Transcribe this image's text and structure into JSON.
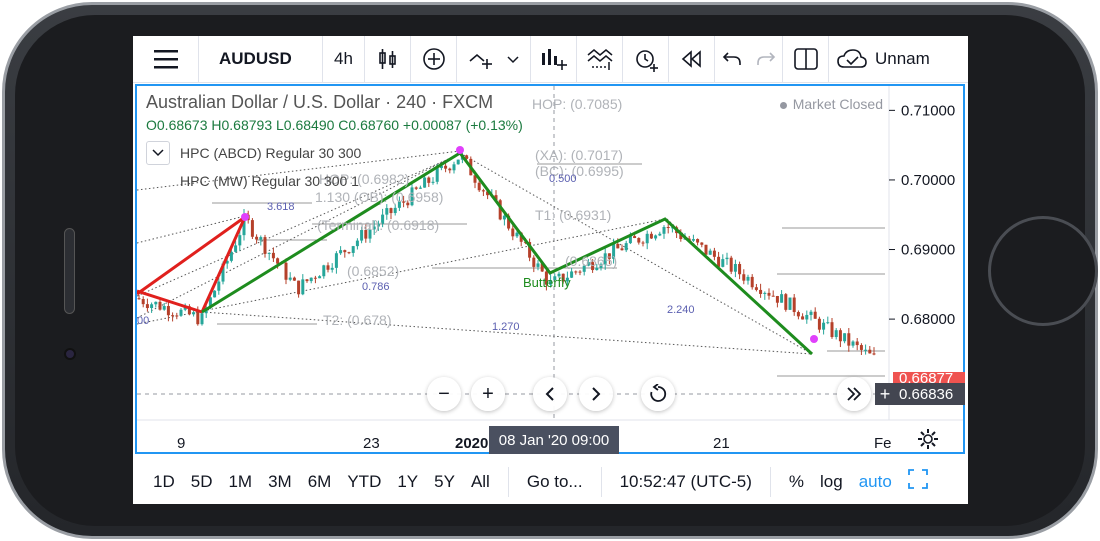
{
  "toolbar": {
    "symbol": "AUDUSD",
    "interval": "4h",
    "save_label": "Unnam",
    "icons": [
      "menu-icon",
      "candles-icon",
      "add-symbol-icon",
      "indicators-icon",
      "chevron-down-icon",
      "chart-type-icon",
      "templates-icon",
      "alert-icon",
      "replay-icon",
      "undo-icon",
      "redo-icon",
      "layout-icon",
      "cloud-icon"
    ]
  },
  "legend": {
    "title": "Australian Dollar / U.S. Dollar · 240 · FXCM",
    "open": "O0.68673",
    "high": "H0.68793",
    "low": "L0.68490",
    "close": "C0.68760",
    "change": "+0.00087 (+0.13%)",
    "study1": "HPC (ABCD) Regular 30 300",
    "study2": "HPC (MW) Regular 30 300 1",
    "market_status": "Market Closed"
  },
  "price_axis": {
    "ticks": [
      "0.71000",
      "0.70000",
      "0.69000",
      "0.68000"
    ],
    "partial_tag": "0.66877",
    "current_price": "0.66836",
    "partial_tag_color": "#ef5350",
    "current_tag_color": "#434651"
  },
  "time_axis": {
    "labels": [
      "9",
      "23",
      "2020",
      "21",
      "Fe"
    ],
    "crosshair_label": "08 Jan '20   09:00"
  },
  "annotations": {
    "hop_top": "HOP: (0.7085)",
    "xa": "(XA): (0.7017)",
    "bc": "(BC): (0.6995)",
    "ratio_500": "0.500",
    "hop_mid": "HOP: (0.6982)",
    "ob": "1.130 (OB): (0.6958)",
    "ratio_3618": "3.618",
    "terminal": "(Terminal): (0.6918)",
    "t1": "T1: (0.6931)",
    "t1_second": "(0.6865)",
    "butterfly": "Butterfly",
    "val_6852": "(0.6852)",
    "ratio_786": "0.786",
    "t2": "T2: (0.678)",
    "ratio_1270": "1.270",
    "ratio_2240": "2.240",
    "left_00": "00"
  },
  "bottombar": {
    "ranges": [
      "1D",
      "5D",
      "1M",
      "3M",
      "6M",
      "YTD",
      "1Y",
      "5Y",
      "All"
    ],
    "goto": "Go to...",
    "clock": "10:52:47 (UTC-5)",
    "percent": "%",
    "log": "log",
    "auto": "auto"
  },
  "colors": {
    "accent": "#2196f3",
    "pattern_green": "#1e8c1e",
    "pattern_red": "#e0201d",
    "candle_up": "#26a69a",
    "candle_down": "#b5402a"
  },
  "chart_data": {
    "type": "candlestick",
    "symbol": "AUDUSD",
    "timeframe": "240",
    "ylim": [
      0.6655,
      0.7135
    ],
    "y_ticks": [
      0.71,
      0.7,
      0.69,
      0.68
    ],
    "pivots": [
      0.683,
      0.68,
      0.6943,
      0.6843,
      0.7035,
      0.685,
      0.6935,
      0.674
    ],
    "current": 0.66836
  }
}
